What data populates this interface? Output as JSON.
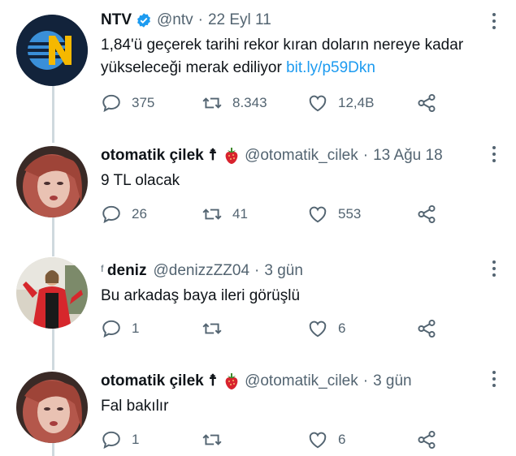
{
  "tweets": [
    {
      "name": "NTV",
      "handle": "@ntv",
      "date": "22 Eyl 11",
      "text": "1,84'ü geçerek tarihi rekor kıran doların nereye kadar yükseleceği merak ediliyor",
      "link": "bit.ly/p59Dkn",
      "replies": "375",
      "retweets": "8.343",
      "likes": "12,4B"
    },
    {
      "name": "otomatik çilek",
      "name_suffix": "☨",
      "handle": "@otomatik_cilek",
      "date": "13 Ağu 18",
      "text": "9 TL olacak",
      "replies": "26",
      "retweets": "41",
      "likes": "553"
    },
    {
      "name": "deniz",
      "name_prefix": "ᶠ",
      "handle": "@denizzZZ04",
      "date": "3 gün",
      "text": "Bu arkadaş baya ileri görüşlü",
      "replies": "1",
      "retweets": "",
      "likes": "6"
    },
    {
      "name": "otomatik çilek",
      "name_suffix": "☨",
      "handle": "@otomatik_cilek",
      "date": "3 gün",
      "text": "Fal bakılır",
      "replies": "1",
      "retweets": "",
      "likes": "6"
    }
  ],
  "icons": {
    "reply": "reply-icon",
    "retweet": "retweet-icon",
    "like": "heart-icon",
    "share": "share-icon",
    "verified": "verified-badge-icon",
    "strawberry": "strawberry-emoji-icon",
    "more": "more-options-icon"
  },
  "colors": {
    "link": "#1d9bf0",
    "verified": "#1d9bf0",
    "muted": "#536471",
    "thread_line": "#cfd9de",
    "ntv_yellow": "#f5b800",
    "ntv_blue": "#3a8fd8"
  }
}
